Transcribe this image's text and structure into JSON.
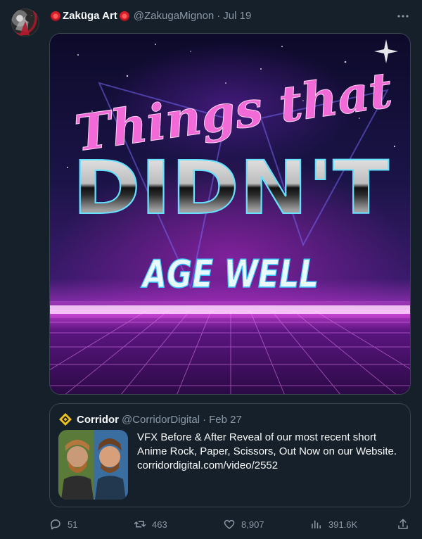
{
  "author": {
    "display_name": "Zaküga Art",
    "handle": "@ZakugaMignon",
    "separator": "·",
    "date": "Jul 19"
  },
  "more_icon": "ellipsis-icon",
  "media": {
    "headline_top": "Things that",
    "headline_middle": "DIDN'T",
    "headline_bottom": "AGE WELL"
  },
  "quote": {
    "display_name": "Corridor",
    "handle": "@CorridorDigital",
    "separator": "·",
    "date": "Feb 27",
    "text_line1": "VFX Before & After Reveal of our most recent short",
    "text_line2": "Anime Rock, Paper, Scissors, Out Now on our Website.",
    "text_line3": "corridordigital.com/video/2552"
  },
  "actions": {
    "replies": "51",
    "retweets": "463",
    "likes": "8,907",
    "views": "391.6K"
  },
  "colors": {
    "background": "#15202b",
    "muted": "#8b98a5",
    "border": "#38444d",
    "text": "#f7f9f9"
  }
}
